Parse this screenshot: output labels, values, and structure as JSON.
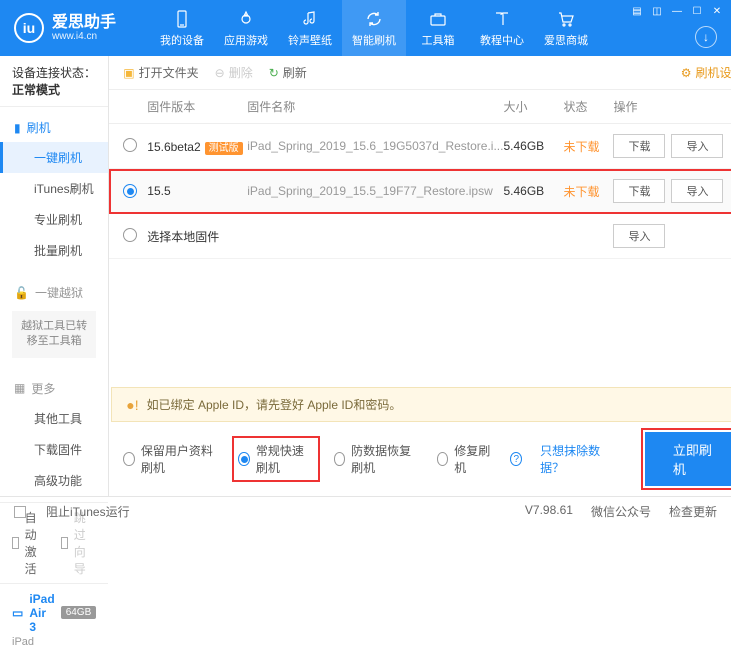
{
  "header": {
    "app_name": "爱思助手",
    "app_url": "www.i4.cn",
    "nav": [
      {
        "label": "我的设备"
      },
      {
        "label": "应用游戏"
      },
      {
        "label": "铃声壁纸"
      },
      {
        "label": "智能刷机"
      },
      {
        "label": "工具箱"
      },
      {
        "label": "教程中心"
      },
      {
        "label": "爱思商城"
      }
    ]
  },
  "sidebar": {
    "conn_label": "设备连接状态：",
    "conn_value": "正常模式",
    "group_flash": "刷机",
    "items_flash": [
      "一键刷机",
      "iTunes刷机",
      "专业刷机",
      "批量刷机"
    ],
    "group_jb": "一键越狱",
    "jb_note": "越狱工具已转移至工具箱",
    "group_more": "更多",
    "items_more": [
      "其他工具",
      "下载固件",
      "高级功能"
    ],
    "auto_activate": "自动激活",
    "skip_guide": "跳过向导",
    "device_name": "iPad Air 3",
    "device_storage": "64GB",
    "device_type": "iPad"
  },
  "toolbar": {
    "open": "打开文件夹",
    "delete": "删除",
    "refresh": "刷新",
    "settings": "刷机设置"
  },
  "table": {
    "h_version": "固件版本",
    "h_name": "固件名称",
    "h_size": "大小",
    "h_status": "状态",
    "h_ops": "操作",
    "rows": [
      {
        "version": "15.6beta2",
        "tag": "测试版",
        "name": "iPad_Spring_2019_15.6_19G5037d_Restore.i...",
        "size": "5.46GB",
        "status": "未下载"
      },
      {
        "version": "15.5",
        "tag": "",
        "name": "iPad_Spring_2019_15.5_19F77_Restore.ipsw",
        "size": "5.46GB",
        "status": "未下载"
      }
    ],
    "local_fw": "选择本地固件",
    "btn_download": "下载",
    "btn_import": "导入"
  },
  "warn": "如已绑定 Apple ID，请先登好 Apple ID和密码。",
  "flash": {
    "opt1": "保留用户资料刷机",
    "opt2": "常规快速刷机",
    "opt3": "防数据恢复刷机",
    "opt4": "修复刷机",
    "link": "只想抹除数据？",
    "go": "立即刷机"
  },
  "footer": {
    "block_itunes": "阻止iTunes运行",
    "version": "V7.98.61",
    "wechat": "微信公众号",
    "update": "检查更新"
  }
}
